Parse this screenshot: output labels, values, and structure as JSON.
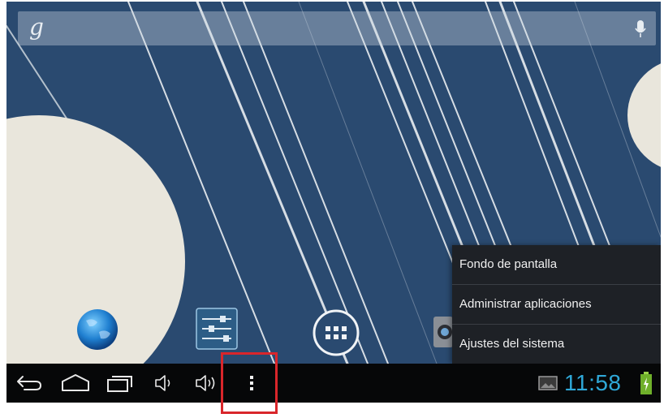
{
  "search_bar": {
    "logo": "g"
  },
  "overflow_menu": {
    "items": [
      {
        "label": "Fondo de pantalla"
      },
      {
        "label": "Administrar aplicaciones"
      },
      {
        "label": "Ajustes del sistema"
      }
    ]
  },
  "status": {
    "time": "11:58"
  },
  "colors": {
    "wallpaper": "#2a4a70",
    "clock": "#2fa8d8",
    "highlight": "#d9262b",
    "menu_bg": "#1e2126"
  },
  "icons": {
    "dock": [
      "browser-globe-icon",
      "settings-sliders-icon",
      "app-drawer-icon",
      "camera-icon"
    ],
    "navbar": [
      "back-icon",
      "home-icon",
      "recent-apps-icon",
      "volume-down-icon",
      "volume-up-icon",
      "menu-dots-icon",
      "screenshot-icon",
      "battery-icon"
    ]
  }
}
